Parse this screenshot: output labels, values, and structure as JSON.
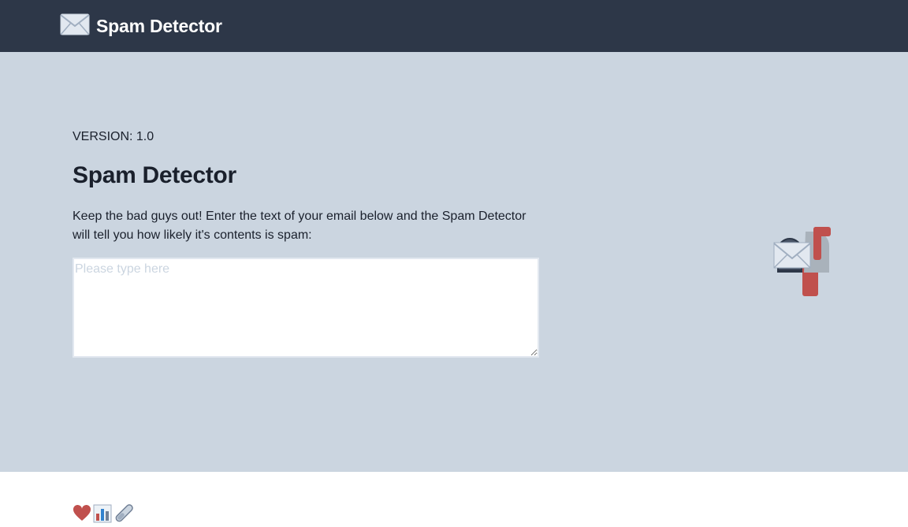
{
  "header": {
    "brand_icon": "envelope-icon",
    "title": "Spam Detector"
  },
  "main": {
    "version": "VERSION: 1.0",
    "title": "Spam Detector",
    "description": "Keep the bad guys out! Enter the text of your email below and the Spam Detector will tell you how likely it's contents is spam:",
    "input": {
      "placeholder": "Please type here",
      "value": ""
    },
    "illustration": "mailbox-icon"
  },
  "footer": {
    "icons": [
      "heart-icon",
      "bar-chart-icon",
      "test-tube-icon"
    ]
  },
  "colors": {
    "header_bg": "#2d3748",
    "hero_bg": "#cbd5e0",
    "text": "#1a202c",
    "accent_red": "#c53030"
  }
}
